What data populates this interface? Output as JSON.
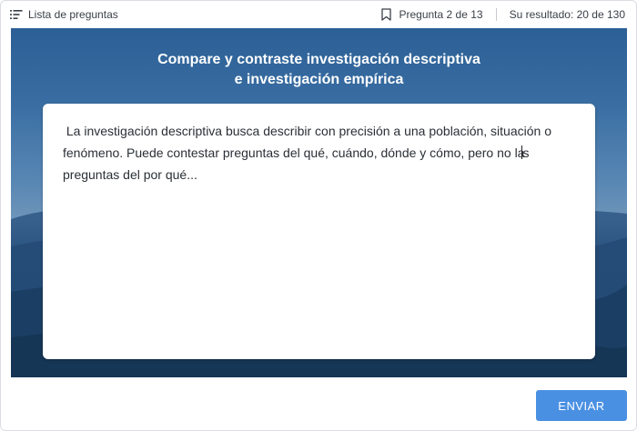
{
  "topbar": {
    "question_list_label": "Lista de preguntas",
    "question_progress": "Pregunta 2 de 13",
    "score": "Su resultado: 20 de 130"
  },
  "question": {
    "title_line1": "Compare y contraste investigación descriptiva",
    "title_line2": "e investigación empírica"
  },
  "answer": {
    "text_before_caret": " La investigación descriptiva busca describir con precisión a una población, situación o fenómeno. Puede contestar preguntas del qué, cuándo, dónde y cómo, pero no la",
    "text_after_caret": "s preguntas del por qué..."
  },
  "footer": {
    "submit_label": "ENVIAR"
  },
  "colors": {
    "accent": "#4a90e2",
    "hero_top": "#2b5f95",
    "hero_bottom": "#183a5d"
  },
  "icons": {
    "question_list": "list-icon",
    "bookmark": "bookmark-icon"
  }
}
